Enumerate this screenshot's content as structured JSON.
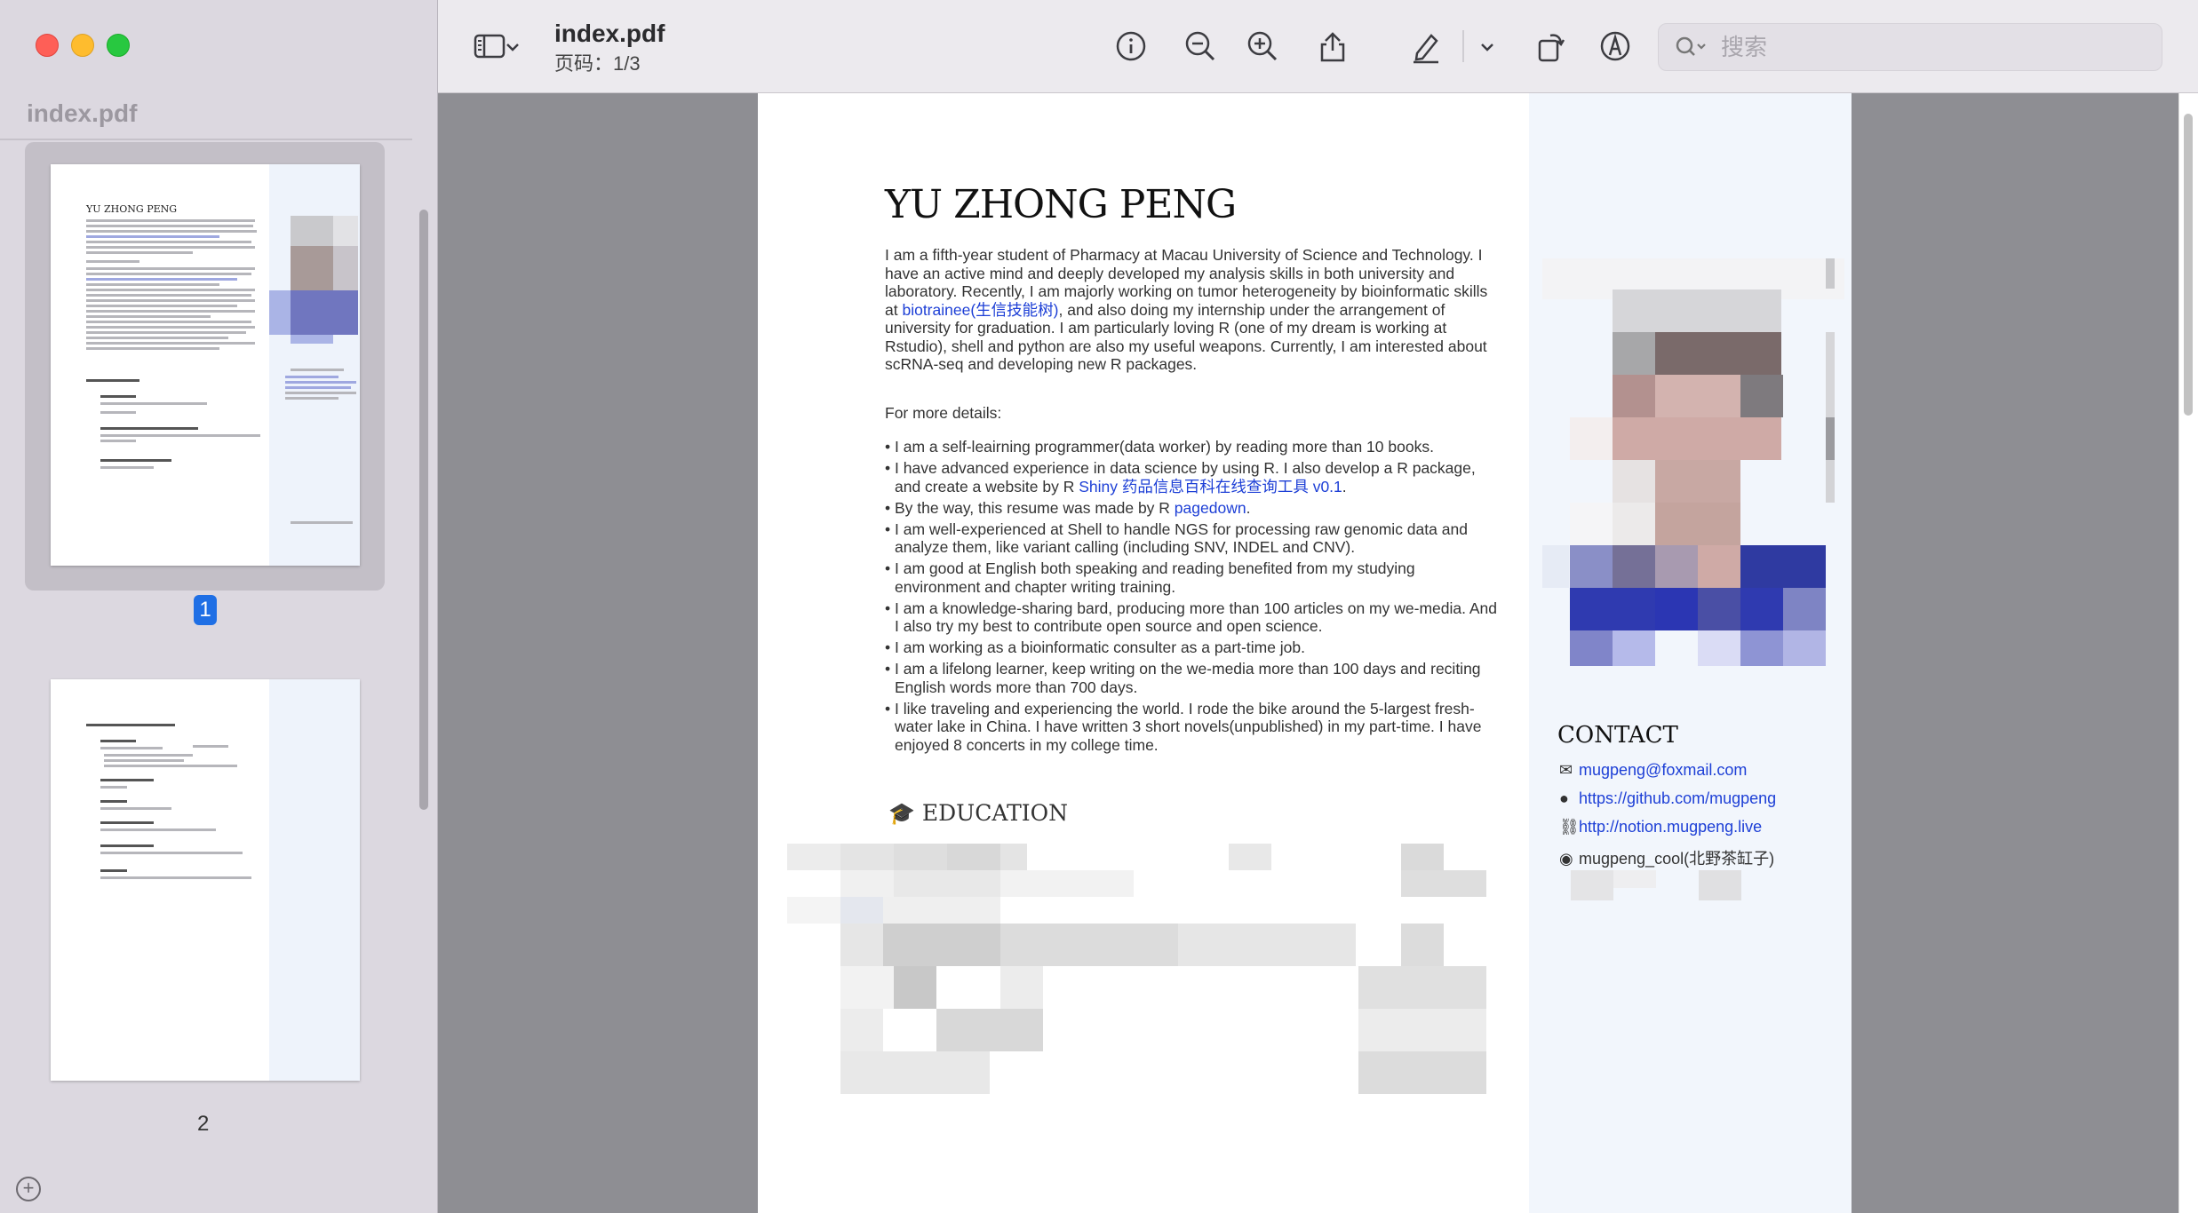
{
  "window": {
    "file_name": "index.pdf",
    "page_indicator": "页码：1/3"
  },
  "sidebar": {
    "title": "index.pdf",
    "thumbnails": [
      {
        "page_label": "1",
        "selected": true
      },
      {
        "page_label": "2",
        "selected": false
      }
    ]
  },
  "toolbar": {
    "icons": [
      "sidebar-toggle-icon",
      "chevron-down-icon",
      "info-icon",
      "zoom-out-icon",
      "zoom-in-icon",
      "share-icon",
      "markup-pen-icon",
      "chevron-down-icon",
      "rotate-icon",
      "annotate-circle-icon"
    ],
    "search_placeholder": "搜索"
  },
  "document": {
    "name": "YU ZHONG PENG",
    "intro_parts": {
      "before_link": "I am a fifth-year student of Pharmacy at Macau University of Science and Technology. I have an active mind and deeply developed my analysis skills in both university and laboratory. Recently, I am majorly working on tumor heterogeneity by bioinformatic skills at ",
      "link": "biotrainee(生信技能树)",
      "after_link": ", and also doing my internship under the arrangement of university for graduation. I am particularly loving R (one of my dream is working at Rstudio), shell and python are also my useful weapons. Currently, I am interested about scRNA-seq and developing new R packages."
    },
    "details_label": "For more details:",
    "bullets": {
      "b1": "I am a self-leairning programmer(data worker) by reading more than 10 books.",
      "b2_before": "I have advanced experience in data science by using R. I also develop a R package, and create a website by R ",
      "b2_link": "Shiny 药品信息百科在线查询工具 v0.1",
      "b2_after": ".",
      "b3_before": "By the way, this resume was made by R ",
      "b3_link": "pagedown",
      "b3_after": ".",
      "b4": "I am well-experienced at Shell to handle NGS for processing raw genomic data and analyze them, like variant calling (including SNV, INDEL and CNV).",
      "b5": "I am good at English both speaking and reading benefited from my studying environment and chapter writing training.",
      "b6": "I am a knowledge-sharing bard, producing more than 100 articles on my we-media. And I also try my best to contribute open source and open science.",
      "b7": "I am working as a bioinformatic consulter as a part-time job.",
      "b8": "I am a lifelong learner, keep writing on the we-media more than 100 days and reciting English words more than 700 days.",
      "b9": "I like traveling and experiencing the world. I rode the bike around the 5-largest fresh-water lake in China. I have written 3 short novels(unpublished) in my part-time. I have enjoyed 8 concerts in my college time."
    },
    "education_heading": "EDUCATION",
    "contact": {
      "heading": "CONTACT",
      "email": "mugpeng@foxmail.com",
      "github": "https://github.com/mugpeng",
      "notion": "http://notion.mugpeng.live",
      "wechat": "mugpeng_cool(北野茶缸子)"
    }
  },
  "colors": {
    "link": "#1d3fd6",
    "selection_badge": "#1f6fe5",
    "page_sidebar": "#f2f6fc"
  }
}
